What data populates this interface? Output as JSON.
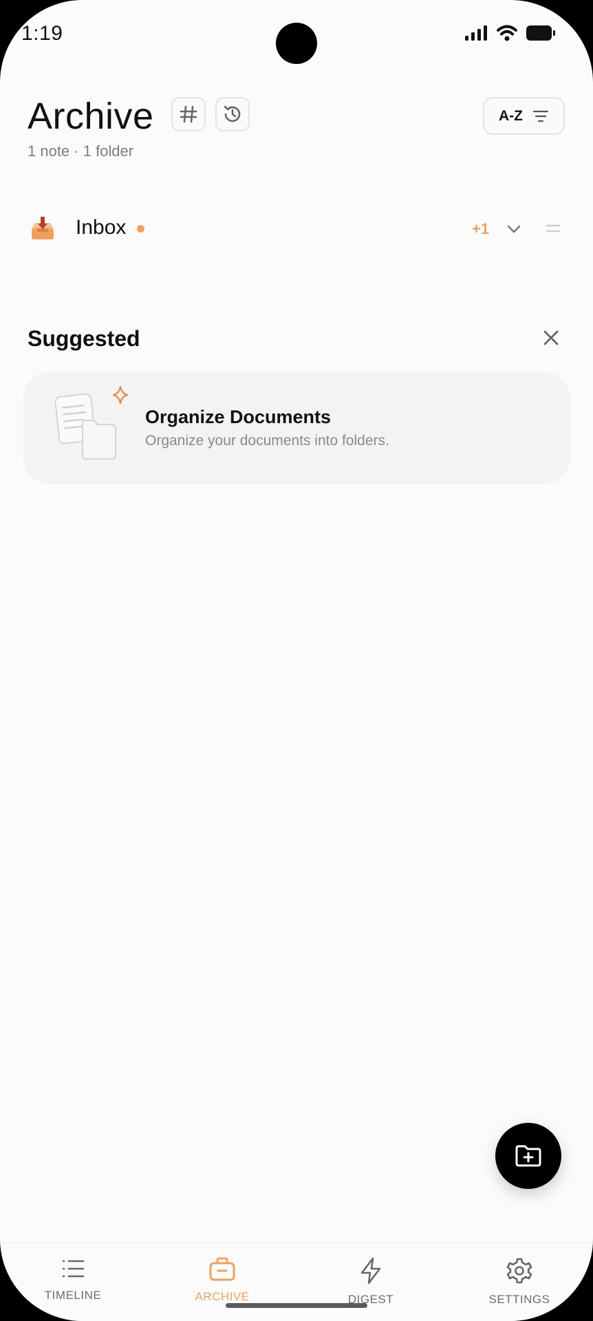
{
  "status_bar": {
    "time": "1:19",
    "icons": [
      "signal-icon",
      "wifi-icon",
      "battery-icon"
    ]
  },
  "header": {
    "title": "Archive",
    "subtitle": "1 note · 1 folder",
    "tags_icon": "hashtag-icon",
    "history_icon": "history-icon",
    "sort_label": "A-Z",
    "sort_icon": "filter-lines-icon"
  },
  "folders": [
    {
      "name": "Inbox",
      "icon": "inbox-tray-icon",
      "count_badge": "+1",
      "has_new_dot": true
    }
  ],
  "suggested": {
    "title": "Suggested",
    "cards": [
      {
        "title": "Organize Documents",
        "description": "Organize your documents into folders."
      }
    ]
  },
  "fab": {
    "icon": "folder-add-icon"
  },
  "bottom_nav": {
    "items": [
      {
        "label": "TIMELINE",
        "icon": "list-icon",
        "active": false
      },
      {
        "label": "ARCHIVE",
        "icon": "briefcase-icon",
        "active": true
      },
      {
        "label": "DIGEST",
        "icon": "lightning-icon",
        "active": false
      },
      {
        "label": "SETTINGS",
        "icon": "gear-icon",
        "active": false
      }
    ]
  },
  "colors": {
    "accent": "#f0a05c",
    "background": "#fbfbfb",
    "card": "#f3f3f3",
    "text": "#111111"
  }
}
